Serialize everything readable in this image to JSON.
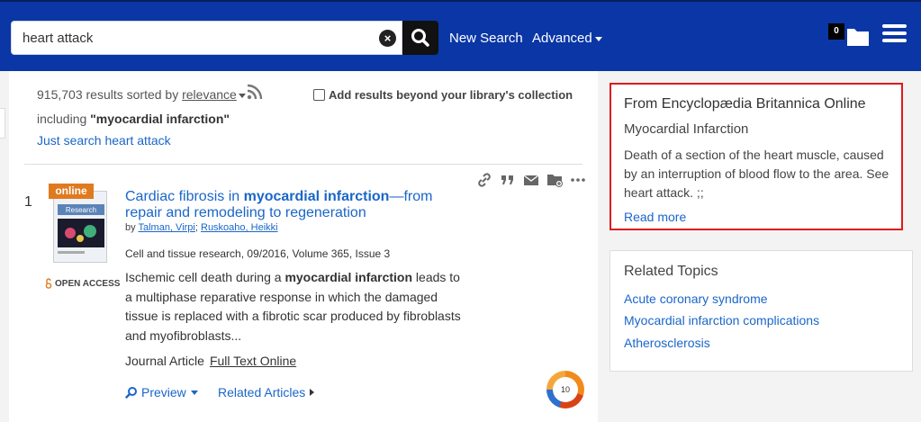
{
  "header": {
    "search_value": "heart attack",
    "clear_label": "×",
    "new_search_label": "New Search",
    "advanced_label": "Advanced",
    "folder_count": "0"
  },
  "results": {
    "count_text": "915,703 results sorted by",
    "sort_value": "relevance",
    "beyond_label": "Add results beyond your library's collection",
    "including_prefix": "including",
    "including_term": "\"myocardial infarction\"",
    "just_search_label": "Just search heart attack"
  },
  "record": {
    "number": "1",
    "online_badge": "online",
    "open_access_label": "OPEN ACCESS",
    "title_part1": "Cardiac fibrosis in ",
    "title_bold": "myocardial infarction",
    "title_part2": "—from repair and remodeling to regeneration",
    "by_label": "by",
    "author1": "Talman, Virpi",
    "author_sep": ";",
    "author2": "Ruskoaho, Heikki",
    "source": "Cell and tissue research, 09/2016, Volume 365, Issue 3",
    "abstract_part1": "Ischemic cell death during a ",
    "abstract_bold": "myocardial infarction",
    "abstract_part2": " leads to a multiphase reparative response in which the damaged tissue is replaced with a fibrotic scar produced by fibroblasts and myofibroblasts...",
    "type": "Journal Article",
    "fulltext_label": "Full Text Online",
    "preview_label": "Preview",
    "related_articles_label": "Related Articles",
    "altmetric_score": "10",
    "thumb_label": "Research"
  },
  "britannica": {
    "from_label": "From Encyclopædia Britannica Online",
    "term": "Myocardial Infarction",
    "definition": "Death of a section of the heart muscle, caused by an interruption of blood flow to the area. See heart attack. ;;",
    "read_more_label": "Read more"
  },
  "related_topics": {
    "title": "Related Topics",
    "items": [
      "Acute coronary syndrome",
      "Myocardial infarction complications",
      "Atherosclerosis"
    ]
  },
  "colors": {
    "header_bg": "#0a36a6",
    "link": "#1a66c9",
    "highlight_border": "#e0191e",
    "online_badge": "#e07a1f"
  }
}
